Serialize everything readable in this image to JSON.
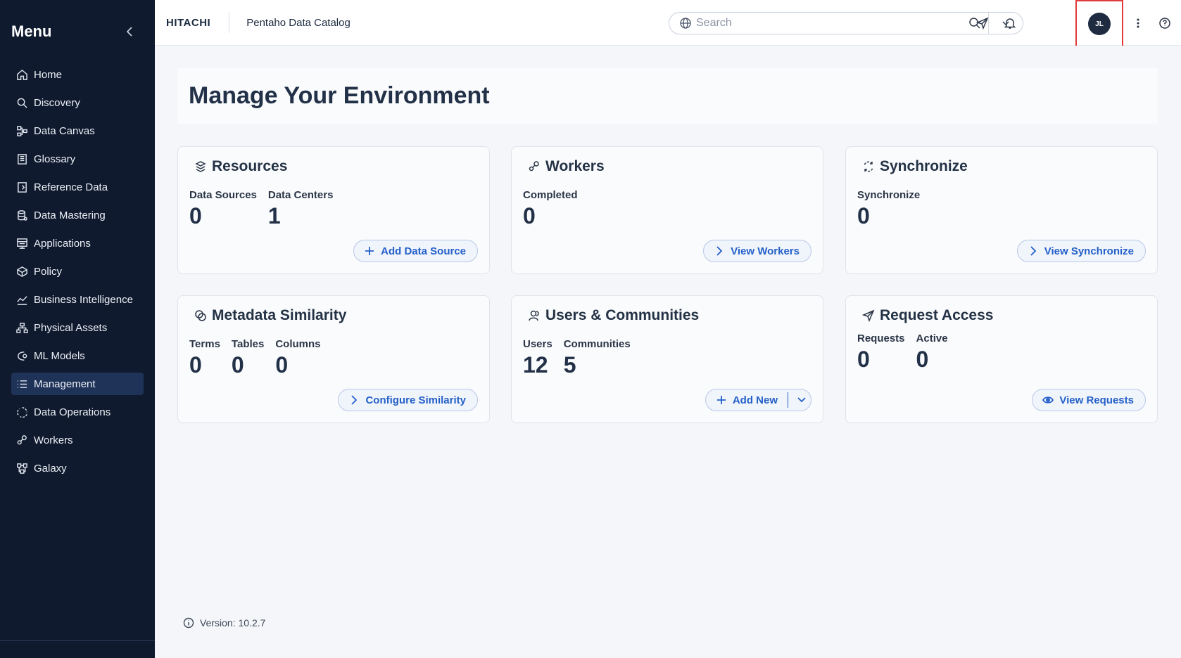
{
  "sidebar": {
    "title": "Menu",
    "items": [
      {
        "label": "Home",
        "icon": "home-icon"
      },
      {
        "label": "Discovery",
        "icon": "search-icon"
      },
      {
        "label": "Data Canvas",
        "icon": "canvas-icon"
      },
      {
        "label": "Glossary",
        "icon": "book-icon"
      },
      {
        "label": "Reference Data",
        "icon": "reference-icon"
      },
      {
        "label": "Data Mastering",
        "icon": "database-icon"
      },
      {
        "label": "Applications",
        "icon": "applications-icon"
      },
      {
        "label": "Policy",
        "icon": "policy-icon"
      },
      {
        "label": "Business Intelligence",
        "icon": "chart-icon"
      },
      {
        "label": "Physical Assets",
        "icon": "hierarchy-icon"
      },
      {
        "label": "ML Models",
        "icon": "ml-icon"
      },
      {
        "label": "Management",
        "icon": "list-icon",
        "active": true
      },
      {
        "label": "Data Operations",
        "icon": "operations-icon"
      },
      {
        "label": "Workers",
        "icon": "workers-icon"
      },
      {
        "label": "Galaxy",
        "icon": "galaxy-icon"
      }
    ]
  },
  "header": {
    "brand": "HITACHI",
    "app_name": "Pentaho Data Catalog",
    "search_placeholder": "Search",
    "avatar_initials": "JL"
  },
  "main": {
    "title": "Manage Your Environment",
    "cards": {
      "resources": {
        "title": "Resources",
        "stats": [
          {
            "label": "Data Sources",
            "value": "0"
          },
          {
            "label": "Data Centers",
            "value": "1"
          }
        ],
        "button": "Add Data Source"
      },
      "workers": {
        "title": "Workers",
        "stats": [
          {
            "label": "Completed",
            "value": "0"
          }
        ],
        "button": "View Workers"
      },
      "synchronize": {
        "title": "Synchronize",
        "stats": [
          {
            "label": "Synchronize",
            "value": "0"
          }
        ],
        "button": "View Synchronize"
      },
      "metadata": {
        "title": "Metadata Similarity",
        "stats": [
          {
            "label": "Terms",
            "value": "0"
          },
          {
            "label": "Tables",
            "value": "0"
          },
          {
            "label": "Columns",
            "value": "0"
          }
        ],
        "button": "Configure Similarity"
      },
      "users": {
        "title": "Users & Communities",
        "stats": [
          {
            "label": "Users",
            "value": "12"
          },
          {
            "label": "Communities",
            "value": "5"
          }
        ],
        "button": "Add New"
      },
      "requests": {
        "title": "Request Access",
        "stats": [
          {
            "label": "Requests",
            "value": "0"
          },
          {
            "label": "Active",
            "value": "0"
          }
        ],
        "button": "View Requests"
      }
    },
    "version": "Version: 10.2.7"
  },
  "colors": {
    "sidebar_bg": "#0f1a2e",
    "sidebar_active": "#1f3358",
    "accent": "#2460c8",
    "highlight_box": "#e03a3a"
  }
}
